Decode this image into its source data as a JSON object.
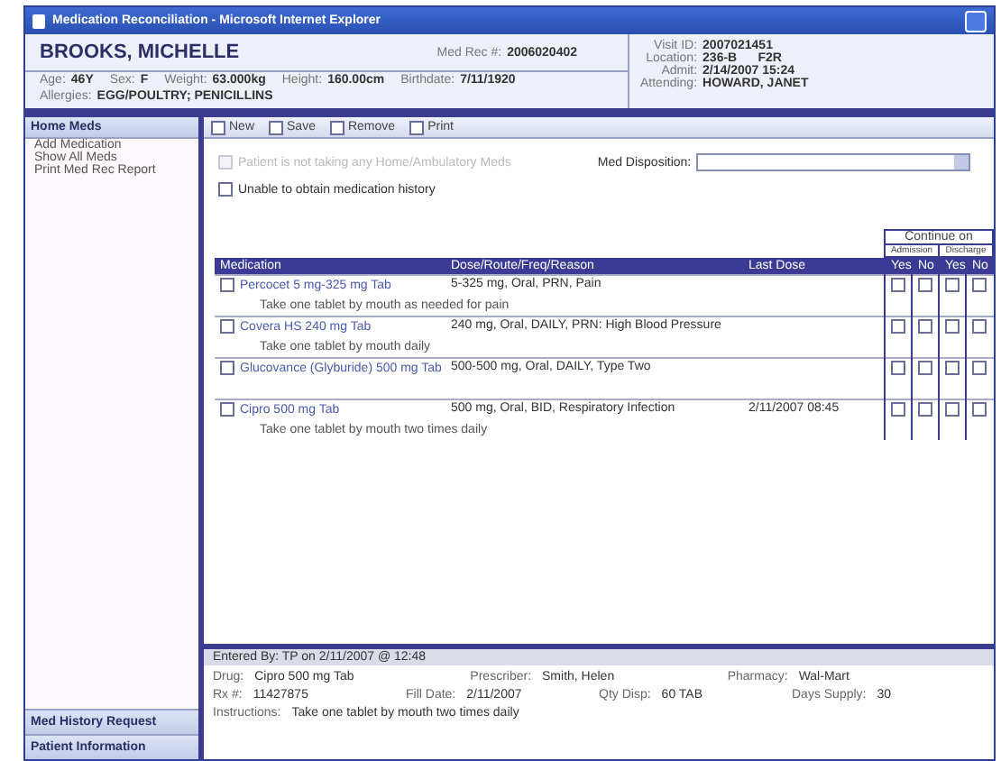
{
  "window": {
    "title": "Medication Reconciliation - Microsoft Internet Explorer"
  },
  "patient": {
    "name": "BROOKS, MICHELLE",
    "med_rec": {
      "label": "Med Rec #:",
      "value": "2006020402"
    },
    "fields": [
      {
        "label": "Age:",
        "value": "46Y"
      },
      {
        "label": "Sex:",
        "value": "F"
      },
      {
        "label": "Weight:",
        "value": "63.000kg"
      },
      {
        "label": "Height:",
        "value": "160.00cm"
      },
      {
        "label": "Birthdate:",
        "value": "7/11/1920"
      }
    ],
    "allergies": {
      "label": "Allergies:",
      "value": "EGG/POULTRY; PENICILLINS"
    },
    "visit": [
      {
        "label": "Visit ID:",
        "value": "2007021451"
      },
      {
        "label": "Location:",
        "value": "236-B      F2R"
      },
      {
        "label": "Admit:",
        "value": "2/14/2007 15:24"
      },
      {
        "label": "Attending:",
        "value": "HOWARD, JANET"
      }
    ]
  },
  "sidebar": {
    "header": "Home Meds",
    "items": [
      "Add Medication",
      "Show All Meds",
      "Print Med Rec Report"
    ],
    "footer_items": [
      "Med History Request",
      "Patient Information"
    ]
  },
  "toolbar": [
    "New",
    "Save",
    "Remove",
    "Print"
  ],
  "options": {
    "not_taking": {
      "label": "Patient is not taking any Home/Ambulatory Meds",
      "checked": false,
      "disabled": true
    },
    "disposition": {
      "label": "Med Disposition:"
    },
    "unable": {
      "label": "Unable to obtain medication history",
      "checked": false,
      "disabled": false
    }
  },
  "table": {
    "group_header": "Continue on",
    "subgroups": [
      "Admission",
      "Discharge"
    ],
    "columns": [
      "Medication",
      "Dose/Route/Freq/Reason",
      "Last Dose",
      "Yes",
      "No",
      "Yes",
      "No"
    ],
    "rows": [
      {
        "medication": "Percocet 5 mg-325 mg Tab",
        "dose": "5-325 mg, Oral, PRN, Pain",
        "last_dose": "",
        "instructions": "Take one tablet by mouth as needed for pain",
        "checked": false,
        "continue": [
          false,
          false,
          false,
          false
        ]
      },
      {
        "medication": "Covera HS 240 mg Tab",
        "dose": "240 mg, Oral, DAILY, PRN: High Blood Pressure",
        "last_dose": "",
        "instructions": "Take one tablet by mouth daily",
        "checked": false,
        "continue": [
          false,
          false,
          false,
          false
        ]
      },
      {
        "medication": "Glucovance (Glyburide) 500 mg Tab",
        "dose": "500-500 mg, Oral, DAILY, Type Two",
        "last_dose": "",
        "instructions": "",
        "checked": false,
        "continue": [
          false,
          false,
          false,
          false
        ]
      },
      {
        "medication": "Cipro 500 mg Tab",
        "dose": "500 mg, Oral, BID, Respiratory Infection",
        "last_dose": "2/11/2007 08:45",
        "instructions": "Take one tablet by mouth two times daily",
        "checked": false,
        "continue": [
          false,
          false,
          false,
          false
        ]
      }
    ]
  },
  "details": {
    "entered_by": "Entered By:    TP on 2/11/2007 @ 12:48",
    "lines": [
      [
        {
          "label": "Drug:",
          "value": "Cipro 500 mg Tab"
        },
        {
          "label": "Prescriber:",
          "value": "Smith, Helen"
        },
        {
          "label": "Pharmacy:",
          "value": "Wal-Mart"
        }
      ],
      [
        {
          "label": "Rx #:",
          "value": "11427875"
        },
        {
          "label": "Fill Date:",
          "value": "2/11/2007"
        },
        {
          "label": "Qty Disp:",
          "value": "60 TAB"
        },
        {
          "label": "Days Supply:",
          "value": "30"
        }
      ],
      [
        {
          "label": "Instructions:",
          "value": "Take one tablet by mouth two times daily"
        }
      ]
    ]
  }
}
